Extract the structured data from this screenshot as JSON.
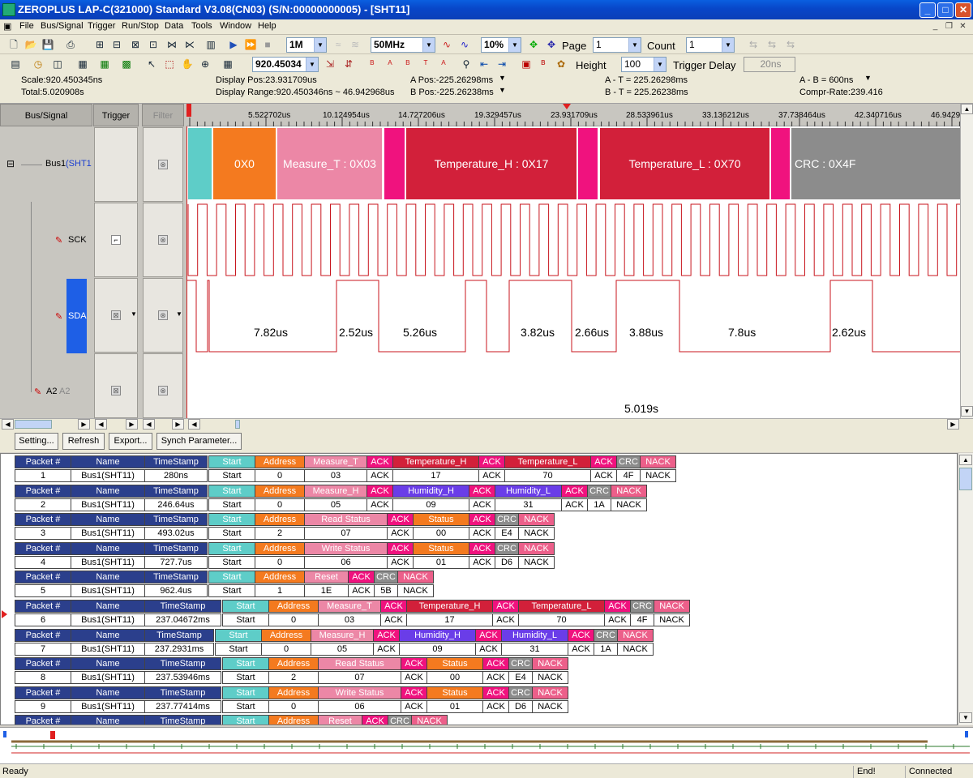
{
  "window": {
    "title": "ZEROPLUS LAP-C(321000) Standard V3.08(CN03) (S/N:00000000005) - [SHT11]"
  },
  "menu": [
    "File",
    "Bus/Signal",
    "Trigger",
    "Run/Stop",
    "Data",
    "Tools",
    "Window",
    "Help"
  ],
  "toolbar": {
    "memory": "1M",
    "frequency": "50MHz",
    "trigger_pos": "10%",
    "page_label": "Page",
    "page_value": "1",
    "count_label": "Count",
    "count_value": "1",
    "zoom_value": "920.45034",
    "height_label": "Height",
    "height_value": "100",
    "trigger_delay_label": "Trigger Delay",
    "trigger_delay_value": "20ns"
  },
  "info": {
    "scale": "Scale:920.450345ns",
    "total": "Total:5.020908s",
    "display_pos": "Display Pos:23.931709us",
    "display_range": "Display Range:920.450346ns ~ 46.942968us",
    "a_pos": "A Pos:-225.26298ms",
    "b_pos": "B Pos:-225.26238ms",
    "a_t": "A - T = 225.26298ms",
    "b_t": "B - T = 225.26238ms",
    "a_b": "A - B = 600ns",
    "compr_rate": "Compr-Rate:239.416"
  },
  "left_panel": {
    "col_bus": "Bus/Signal",
    "col_trigger": "Trigger",
    "col_filter": "Filter",
    "bus_name": "Bus1",
    "bus_sub": "(SHT1",
    "sig_sck": "SCK",
    "sig_sda": "SDA",
    "sig_a2": "A2",
    "sig_a2_sub": "A2"
  },
  "ruler_ticks": [
    "5.522702us",
    "10.124954us",
    "14.727206us",
    "19.329457us",
    "23.931709us",
    "28.533961us",
    "33.136212us",
    "37.738464us",
    "42.340716us",
    "46.9429"
  ],
  "bus_segments": [
    {
      "label": "",
      "color": "#5ecdc8"
    },
    {
      "label": "0X0",
      "color": "#f47a1f"
    },
    {
      "label": "Measure_T : 0X03",
      "color": "#ec87a6"
    },
    {
      "label": "",
      "color": "#f0127e"
    },
    {
      "label": "Temperature_H : 0X17",
      "color": "#d2203a"
    },
    {
      "label": "",
      "color": "#f0127e"
    },
    {
      "label": "Temperature_L : 0X70",
      "color": "#d2203a"
    },
    {
      "label": "",
      "color": "#f0127e"
    },
    {
      "label": "CRC : 0X4F",
      "color": "#8c8c8c"
    }
  ],
  "sda_durations": [
    "7.82us",
    "2.52us",
    "5.26us",
    "3.82us",
    "2.66us",
    "3.88us",
    "7.8us",
    "2.62us"
  ],
  "a2_label": "5.019s",
  "buttons": {
    "setting": "Setting...",
    "refresh": "Refresh",
    "export": "Export...",
    "synch": "Synch Parameter..."
  },
  "packets": [
    {
      "num": "1",
      "name": "Bus1(SHT11)",
      "ts": "280ns",
      "fields": [
        [
          "Start",
          "Start",
          "start"
        ],
        [
          "Address",
          "0",
          "addr"
        ],
        [
          "Measure_T",
          "03",
          "cmd"
        ],
        [
          "ACK",
          "ACK",
          "ack"
        ],
        [
          "Temperature_H",
          "17",
          "data"
        ],
        [
          "ACK",
          "ACK",
          "ack"
        ],
        [
          "Temperature_L",
          "70",
          "data"
        ],
        [
          "ACK",
          "ACK",
          "ack"
        ],
        [
          "CRC",
          "4F",
          "crc"
        ],
        [
          "NACK",
          "NACK",
          "nack"
        ]
      ]
    },
    {
      "num": "2",
      "name": "Bus1(SHT11)",
      "ts": "246.64us",
      "fields": [
        [
          "Start",
          "Start",
          "start"
        ],
        [
          "Address",
          "0",
          "addr"
        ],
        [
          "Measure_H",
          "05",
          "cmd"
        ],
        [
          "ACK",
          "ACK",
          "ack"
        ],
        [
          "Humidity_H",
          "09",
          "hum"
        ],
        [
          "ACK",
          "ACK",
          "ack"
        ],
        [
          "Humidity_L",
          "31",
          "hum"
        ],
        [
          "ACK",
          "ACK",
          "ack"
        ],
        [
          "CRC",
          "1A",
          "crc"
        ],
        [
          "NACK",
          "NACK",
          "nack"
        ]
      ]
    },
    {
      "num": "3",
      "name": "Bus1(SHT11)",
      "ts": "493.02us",
      "fields": [
        [
          "Start",
          "Start",
          "start"
        ],
        [
          "Address",
          "2",
          "addr"
        ],
        [
          "Read Status",
          "07",
          "cmd"
        ],
        [
          "ACK",
          "ACK",
          "ack"
        ],
        [
          "Status",
          "00",
          "status"
        ],
        [
          "ACK",
          "ACK",
          "ack"
        ],
        [
          "CRC",
          "E4",
          "crc"
        ],
        [
          "NACK",
          "NACK",
          "nack"
        ]
      ]
    },
    {
      "num": "4",
      "name": "Bus1(SHT11)",
      "ts": "727.7us",
      "fields": [
        [
          "Start",
          "Start",
          "start"
        ],
        [
          "Address",
          "0",
          "addr"
        ],
        [
          "Write Status",
          "06",
          "cmd"
        ],
        [
          "ACK",
          "ACK",
          "ack"
        ],
        [
          "Status",
          "01",
          "status"
        ],
        [
          "ACK",
          "ACK",
          "ack"
        ],
        [
          "CRC",
          "D6",
          "crc"
        ],
        [
          "NACK",
          "NACK",
          "nack"
        ]
      ]
    },
    {
      "num": "5",
      "name": "Bus1(SHT11)",
      "ts": "962.4us",
      "fields": [
        [
          "Start",
          "Start",
          "start"
        ],
        [
          "Address",
          "1",
          "addr"
        ],
        [
          "Reset",
          "1E",
          "cmd"
        ],
        [
          "ACK",
          "ACK",
          "ack"
        ],
        [
          "CRC",
          "5B",
          "crc"
        ],
        [
          "NACK",
          "NACK",
          "nack"
        ]
      ]
    },
    {
      "num": "6",
      "name": "Bus1(SHT11)",
      "ts": "237.04672ms",
      "fields": [
        [
          "Start",
          "Start",
          "start"
        ],
        [
          "Address",
          "0",
          "addr"
        ],
        [
          "Measure_T",
          "03",
          "cmd"
        ],
        [
          "ACK",
          "ACK",
          "ack"
        ],
        [
          "Temperature_H",
          "17",
          "data"
        ],
        [
          "ACK",
          "ACK",
          "ack"
        ],
        [
          "Temperature_L",
          "70",
          "data"
        ],
        [
          "ACK",
          "ACK",
          "ack"
        ],
        [
          "CRC",
          "4F",
          "crc"
        ],
        [
          "NACK",
          "NACK",
          "nack"
        ]
      ]
    },
    {
      "num": "7",
      "name": "Bus1(SHT11)",
      "ts": "237.2931ms",
      "fields": [
        [
          "Start",
          "Start",
          "start"
        ],
        [
          "Address",
          "0",
          "addr"
        ],
        [
          "Measure_H",
          "05",
          "cmd"
        ],
        [
          "ACK",
          "ACK",
          "ack"
        ],
        [
          "Humidity_H",
          "09",
          "hum"
        ],
        [
          "ACK",
          "ACK",
          "ack"
        ],
        [
          "Humidity_L",
          "31",
          "hum"
        ],
        [
          "ACK",
          "ACK",
          "ack"
        ],
        [
          "CRC",
          "1A",
          "crc"
        ],
        [
          "NACK",
          "NACK",
          "nack"
        ]
      ]
    },
    {
      "num": "8",
      "name": "Bus1(SHT11)",
      "ts": "237.53946ms",
      "fields": [
        [
          "Start",
          "Start",
          "start"
        ],
        [
          "Address",
          "2",
          "addr"
        ],
        [
          "Read Status",
          "07",
          "cmd"
        ],
        [
          "ACK",
          "ACK",
          "ack"
        ],
        [
          "Status",
          "00",
          "status"
        ],
        [
          "ACK",
          "ACK",
          "ack"
        ],
        [
          "CRC",
          "E4",
          "crc"
        ],
        [
          "NACK",
          "NACK",
          "nack"
        ]
      ]
    },
    {
      "num": "9",
      "name": "Bus1(SHT11)",
      "ts": "237.77414ms",
      "fields": [
        [
          "Start",
          "Start",
          "start"
        ],
        [
          "Address",
          "0",
          "addr"
        ],
        [
          "Write Status",
          "06",
          "cmd"
        ],
        [
          "ACK",
          "ACK",
          "ack"
        ],
        [
          "Status",
          "01",
          "status"
        ],
        [
          "ACK",
          "ACK",
          "ack"
        ],
        [
          "CRC",
          "D6",
          "crc"
        ],
        [
          "NACK",
          "NACK",
          "nack"
        ]
      ]
    },
    {
      "num": "",
      "name": "",
      "ts": "",
      "fields": [
        [
          "Start",
          "",
          "start"
        ],
        [
          "Address",
          "",
          "addr"
        ],
        [
          "Reset",
          "",
          "cmd"
        ],
        [
          "ACK",
          "",
          "ack"
        ],
        [
          "CRC",
          "",
          "crc"
        ],
        [
          "NACK",
          "",
          "nack"
        ]
      ]
    }
  ],
  "table_headers": {
    "num": "Packet #",
    "name": "Name",
    "ts": "TimeStamp"
  },
  "field_colors": {
    "start": "#5ecdc8",
    "addr": "#f47a1f",
    "cmd": "#ec87a6",
    "ack": "#f0127e",
    "data": "#d2203a",
    "hum": "#6a3de8",
    "status": "#f47a1f",
    "crc": "#8c8c8c",
    "nack": "#ec5f8a",
    "hdr": "#2b3f8c"
  },
  "status": {
    "left": "Ready",
    "end": "End!",
    "conn": "Connected"
  }
}
